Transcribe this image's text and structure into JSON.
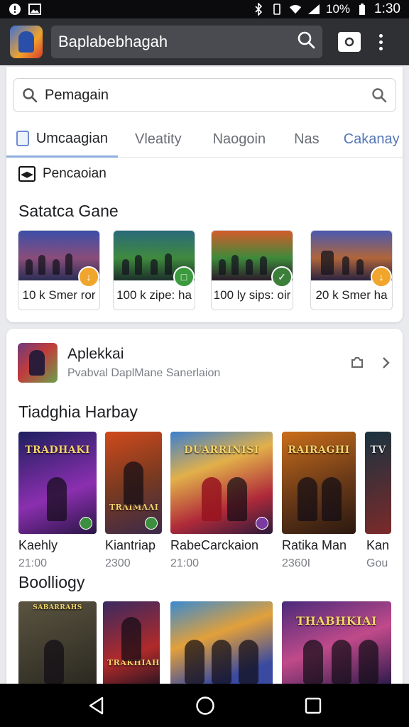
{
  "status_bar": {
    "battery": "10%",
    "time": "1:30"
  },
  "browser": {
    "url": "Baplabebhagah"
  },
  "search": {
    "placeholder": "Pemagain"
  },
  "tabs": [
    {
      "label": "Umcaagian"
    },
    {
      "label": "Vleatity"
    },
    {
      "label": "Naogoin"
    },
    {
      "label": "Nas"
    },
    {
      "label": "Cakanay"
    }
  ],
  "pencarian_label": "Pencaoian",
  "section1_title": "Satatca Gane",
  "quick_tiles": [
    {
      "caption": "10 k Smer ror"
    },
    {
      "caption": "100 k zipe: ha"
    },
    {
      "caption": "100 ly sips: oir"
    },
    {
      "caption": "20 k Smer ha"
    }
  ],
  "developer": {
    "name": "Aplekkai",
    "subtitle": "Pvabval DaplMane Sanerlaion"
  },
  "section2_title": "Tiadghia Harbay",
  "games": [
    {
      "poster_title": "TRADHAKI",
      "name": "Kaehly",
      "meta": "21:00",
      "colors": [
        "#1d1f5e",
        "#8b2fb0"
      ]
    },
    {
      "poster_title": "TRAIMAAI",
      "name": "Kiantriap",
      "meta": "2300",
      "colors": [
        "#d04a1d",
        "#3a2a4a"
      ]
    },
    {
      "poster_title": "DUARRINISI",
      "name": "RabeCarckaion",
      "meta": "21:00",
      "colors": [
        "#3a7fd0",
        "#b02a3a"
      ]
    },
    {
      "poster_title": "RAIRAGHI",
      "name": "Ratika Man",
      "meta": "2360I",
      "colors": [
        "#c96d1a",
        "#2a1810"
      ]
    },
    {
      "poster_title": "TV",
      "name": "Kan",
      "meta": "Gou",
      "colors": [
        "#1a3340",
        "#7b2a2a"
      ]
    }
  ],
  "section3_title": "Boolliogy",
  "bottom_posters": [
    {
      "poster_title": "SABARRAHS"
    },
    {
      "poster_title": "TRAKHIAH"
    },
    {
      "poster_title": ""
    },
    {
      "poster_title": "THABHKIAI"
    }
  ]
}
